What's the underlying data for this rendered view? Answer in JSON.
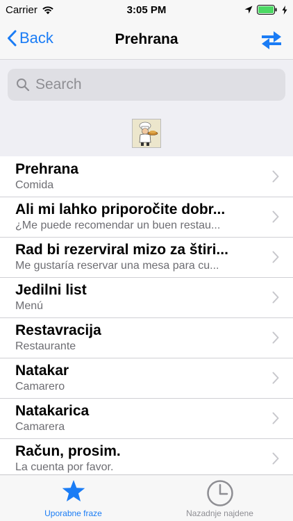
{
  "status_bar": {
    "carrier": "Carrier",
    "time": "3:05 PM"
  },
  "nav": {
    "back_label": "Back",
    "title": "Prehrana",
    "accent_color": "#1a7cf5"
  },
  "search": {
    "placeholder": "Search"
  },
  "list": {
    "items": [
      {
        "title": "Prehrana",
        "subtitle": "Comida"
      },
      {
        "title": "Ali mi lahko priporočite dobr...",
        "subtitle": "¿Me puede recomendar un buen restau..."
      },
      {
        "title": "Rad bi rezerviral mizo za štiri...",
        "subtitle": "Me gustaría reservar una mesa para cu..."
      },
      {
        "title": "Jedilni list",
        "subtitle": "Menú"
      },
      {
        "title": "Restavracija",
        "subtitle": "Restaurante"
      },
      {
        "title": "Natakar",
        "subtitle": "Camarero"
      },
      {
        "title": "Natakarica",
        "subtitle": "Camarera"
      },
      {
        "title": "Račun, prosim.",
        "subtitle": "La cuenta por favor."
      }
    ]
  },
  "tab_bar": {
    "tabs": [
      {
        "label": "Uporabne fraze",
        "icon": "star-icon",
        "active": true
      },
      {
        "label": "Nazadnje najdene",
        "icon": "clock-icon",
        "active": false
      }
    ]
  }
}
